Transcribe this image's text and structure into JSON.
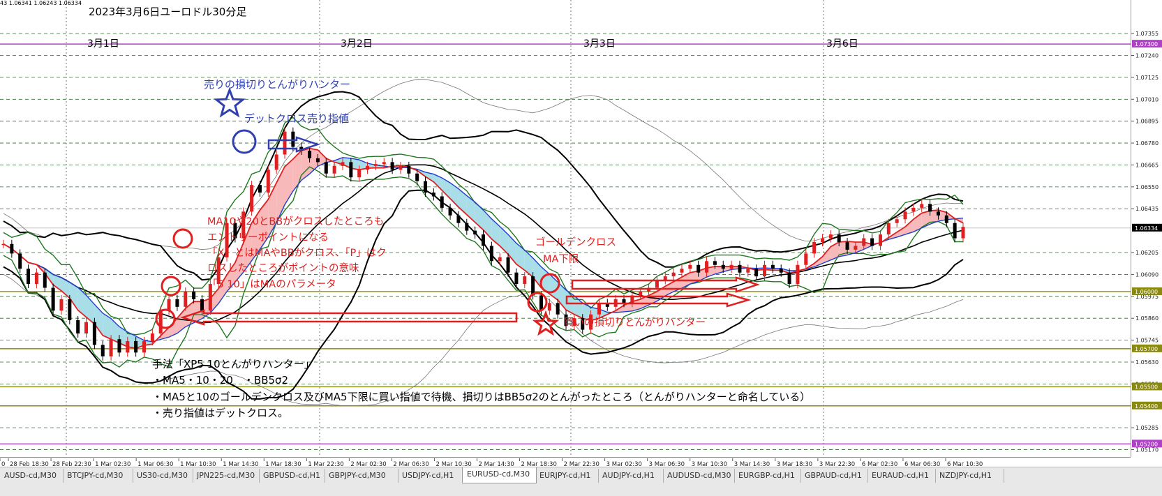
{
  "header": {
    "ohlc_text": "43 1.06341 1.06243 1.06334"
  },
  "chart_data": {
    "type": "candlestick",
    "title": "2023年3月6日ユーロドル30分足",
    "instrument": "EURUSD-cd,M30",
    "day_labels": [
      "3月1日",
      "3月2日",
      "3月3日",
      "3月6日"
    ],
    "time_ticks": [
      "0",
      "28 Feb 18:30",
      "28 Feb 22:30",
      "1 Mar 02:30",
      "1 Mar 06:30",
      "1 Mar 10:30",
      "1 Mar 14:30",
      "1 Mar 18:30",
      "1 Mar 22:30",
      "2 Mar 02:30",
      "2 Mar 06:30",
      "2 Mar 10:30",
      "2 Mar 14:30",
      "2 Mar 18:30",
      "2 Mar 22:30",
      "3 Mar 02:30",
      "3 Mar 06:30",
      "3 Mar 10:30",
      "3 Mar 14:30",
      "3 Mar 18:30",
      "3 Mar 22:30",
      "6 Mar 02:30",
      "6 Mar 06:30",
      "6 Mar 10:30"
    ],
    "price_ticks": [
      "1.07355",
      "1.07240",
      "1.07125",
      "1.07010",
      "1.06895",
      "1.06780",
      "1.06665",
      "1.06550",
      "1.06435",
      "1.06205",
      "1.06090",
      "1.05975",
      "1.05860",
      "1.05745",
      "1.05630",
      "1.05515",
      "1.05285",
      "1.05170"
    ],
    "highlighted_levels": [
      {
        "price": "1.07300",
        "color": "#b040c8"
      },
      {
        "price": "1.06000",
        "color": "#8a8a10"
      },
      {
        "price": "1.05700",
        "color": "#8a8a10"
      },
      {
        "price": "1.05500",
        "color": "#8a8a10"
      },
      {
        "price": "1.05400",
        "color": "#8a8a10"
      },
      {
        "price": "1.05200",
        "color": "#b040c8"
      }
    ],
    "current_price": "1.06334",
    "ylim": [
      1.0515,
      1.0748
    ],
    "grid": true,
    "series_prices": [
      1.0625,
      1.062,
      1.0612,
      1.0604,
      1.061,
      1.0602,
      1.059,
      1.0596,
      1.0585,
      1.0578,
      1.0584,
      1.0572,
      1.0566,
      1.0575,
      1.0568,
      1.0574,
      1.0568,
      1.0574,
      1.0578,
      1.059,
      1.0596,
      1.0592,
      1.06,
      1.0596,
      1.059,
      1.0604,
      1.0618,
      1.0636,
      1.0628,
      1.0642,
      1.0656,
      1.0652,
      1.0664,
      1.0672,
      1.0684,
      1.0676,
      1.0674,
      1.067,
      1.0668,
      1.0662,
      1.0666,
      1.0668,
      1.066,
      1.0664,
      1.0666,
      1.0667,
      1.0668,
      1.0664,
      1.0666,
      1.0662,
      1.0658,
      1.0652,
      1.065,
      1.0644,
      1.064,
      1.0636,
      1.0632,
      1.063,
      1.0624,
      1.0616,
      1.0618,
      1.061,
      1.0604,
      1.0608,
      1.0598,
      1.059,
      1.0594,
      1.0588,
      1.0582,
      1.0586,
      1.058,
      1.0588,
      1.0594,
      1.0592,
      1.0596,
      1.0594,
      1.0598,
      1.06,
      1.0602,
      1.0606,
      1.0608,
      1.061,
      1.0612,
      1.0614,
      1.061,
      1.0616,
      1.0614,
      1.0612,
      1.0614,
      1.061,
      1.0612,
      1.0608,
      1.0614,
      1.0612,
      1.061,
      1.0604,
      1.0614,
      1.062,
      1.0626,
      1.0628,
      1.063,
      1.0626,
      1.0622,
      1.0624,
      1.0628,
      1.0624,
      1.063,
      1.0636,
      1.0638,
      1.0642,
      1.0644,
      1.0646,
      1.0642,
      1.064,
      1.0636,
      1.0628,
      1.0634
    ],
    "annotations": [
      {
        "text": "売りの損切りとんがりハンター",
        "color": "#3040b0"
      },
      {
        "text": "デットクロス売り指値",
        "color": "#3040b0"
      },
      {
        "text": "MA10や20とBBがクロスしたところも",
        "color": "#e02020"
      },
      {
        "text": "エントリーポイントになる",
        "color": "#e02020"
      },
      {
        "text": "「X」とはMAやBBがクロス、「P」はク",
        "color": "#e02020"
      },
      {
        "text": "ロスしたところがポイントの意味",
        "color": "#e02020"
      },
      {
        "text": "「5 10」はMAのパラメータ",
        "color": "#e02020"
      },
      {
        "text": "ゴールデンクロス",
        "color": "#e02020"
      },
      {
        "text": "MA下限",
        "color": "#e02020"
      },
      {
        "text": "買いの損切りとんがりハンター",
        "color": "#e02020"
      }
    ],
    "method_text": [
      "手法「XP5 10とんがりハンター」",
      "・MA5・10・20　・BB5σ2",
      "・MA5と10のゴールデンクロス及びMA5下限に買い指値で待機、損切りはBB5σ2のとんがったところ（とんがりハンターと命名している）",
      "・売り指値はデットクロス。"
    ],
    "colors": {
      "bull": "#e02020",
      "bear": "#000000",
      "ma_fill_up": "#f7b9b9",
      "ma_fill_down": "#a9dde8",
      "bb_inner": "#207820",
      "bb_outer": "#000000",
      "marker_red": "#e02020",
      "marker_blue": "#3040b0"
    }
  },
  "tabs": [
    {
      "label": "AUSD-cd,M30"
    },
    {
      "label": "BTCJPY-cd,M30"
    },
    {
      "label": "US30-cd,M30"
    },
    {
      "label": "JPN225-cd,M30"
    },
    {
      "label": "GBPUSD-cd,H1"
    },
    {
      "label": "GBPJPY-cd,M30"
    },
    {
      "label": "USDJPY-cd,H1"
    },
    {
      "label": "EURUSD-cd,M30",
      "active": true
    },
    {
      "label": "EURJPY-cd,H1"
    },
    {
      "label": "AUDJPY-cd,H1"
    },
    {
      "label": "AUDUSD-cd,M30"
    },
    {
      "label": "EURGBP-cd,H1"
    },
    {
      "label": "GBPAUD-cd,H1"
    },
    {
      "label": "EURAUD-cd,H1"
    },
    {
      "label": "NZDJPY-cd,H1"
    }
  ]
}
